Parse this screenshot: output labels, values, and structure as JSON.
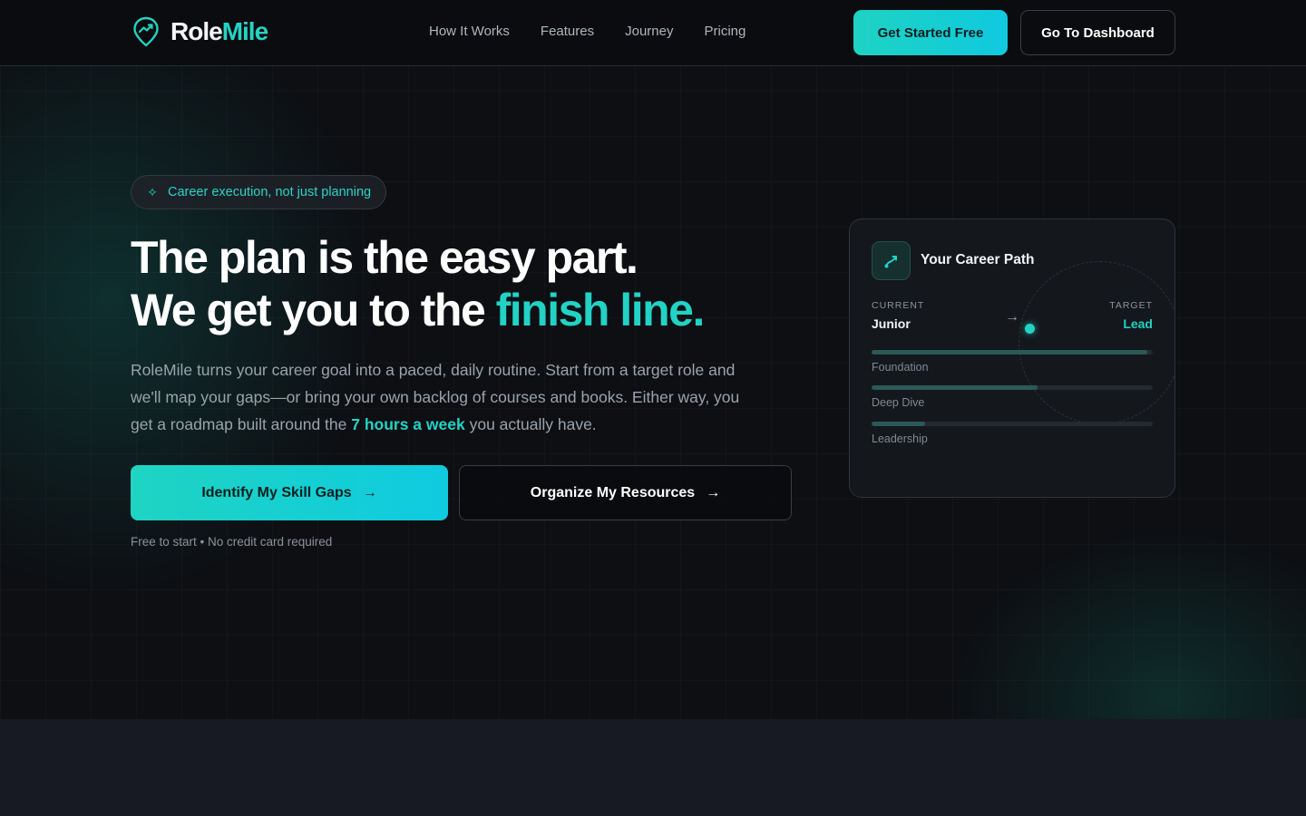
{
  "nav": {
    "brand_a": "Role",
    "brand_b": "Mile",
    "links": [
      "How It Works",
      "Features",
      "Journey",
      "Pricing"
    ],
    "cta_primary": "Get Started Free",
    "cta_secondary": "Go To Dashboard"
  },
  "hero": {
    "pill": "Career execution, not just planning",
    "headline_1": "The plan is the easy part.",
    "headline_2a": "We get you to the ",
    "headline_2b": "finish line.",
    "desc_a": "RoleMile turns your career goal into a paced, daily routine. Start from a target role and we'll map your gaps—or bring your own backlog of courses and books. Either way, you get a roadmap built around the ",
    "desc_hl": "7 hours a week",
    "desc_b": " you actually have.",
    "btn_skill": "Identify My Skill Gaps",
    "btn_org": "Organize My Resources",
    "note": "Free to start • No credit card required"
  },
  "card": {
    "title": "Your Career Path",
    "current_label": "CURRENT",
    "current_value": "Junior",
    "target_label": "TARGET",
    "target_value": "Lead",
    "stages": [
      {
        "name": "Foundation",
        "progress": 0.98
      },
      {
        "name": "Deep Dive",
        "progress": 0.59
      },
      {
        "name": "Leadership",
        "progress": 0.19
      }
    ]
  },
  "colors": {
    "accent": "#22d3c5",
    "background": "#0d0f13"
  }
}
